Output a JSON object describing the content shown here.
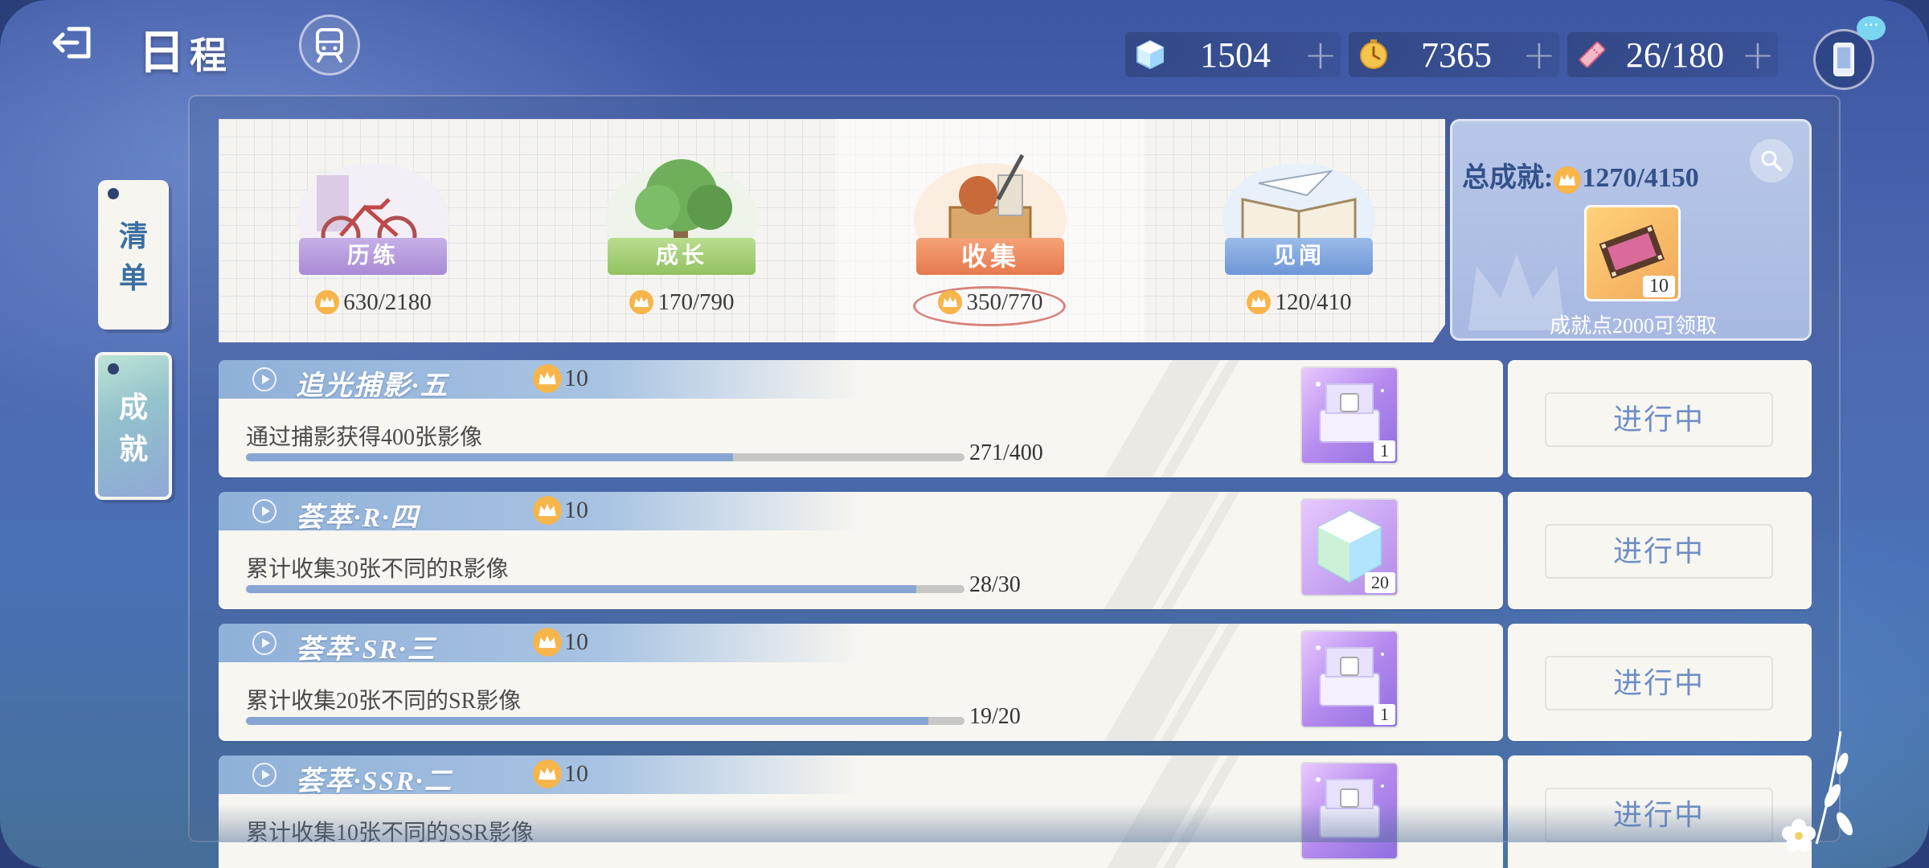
{
  "header": {
    "title_main": "日",
    "title_rest": "程"
  },
  "currencies": [
    {
      "icon": "crystal-icon",
      "value": "1504"
    },
    {
      "icon": "coin-icon",
      "value": "7365"
    },
    {
      "icon": "ticket-icon",
      "value": "26/180"
    }
  ],
  "side_tabs": {
    "list": [
      "清",
      "单"
    ],
    "achievement": [
      "成",
      "就"
    ]
  },
  "categories": [
    {
      "label": "历练",
      "score": "630/2180",
      "ribbon_color": "#b9a0dd",
      "icon": "bicycle-icon"
    },
    {
      "label": "成长",
      "score": "170/790",
      "ribbon_color": "#a6cf7a",
      "icon": "tree-icon"
    },
    {
      "label": "收集",
      "score": "350/770",
      "ribbon_color": "#ef9a70",
      "icon": "collection-box-icon"
    },
    {
      "label": "见闻",
      "score": "120/410",
      "ribbon_color": "#7ea6e0",
      "icon": "book-icon"
    }
  ],
  "active_category": 2,
  "total": {
    "label": "总成就:",
    "score": "1270/4150",
    "reward_count": "10",
    "hint": "成就点2000可领取"
  },
  "achievements": [
    {
      "name": "追光捕影·五",
      "points": "10",
      "desc": "通过捕影获得400张影像",
      "progress": "271/400",
      "fraction": 0.6775,
      "reward_count": "1",
      "reward_icon": "camera-box-icon",
      "status": "进行中"
    },
    {
      "name": "荟萃·R·四",
      "points": "10",
      "desc": "累计收集30张不同的R影像",
      "progress": "28/30",
      "fraction": 0.9333,
      "reward_count": "20",
      "reward_icon": "crystal-cube-icon",
      "status": "进行中"
    },
    {
      "name": "荟萃·SR·三",
      "points": "10",
      "desc": "累计收集20张不同的SR影像",
      "progress": "19/20",
      "fraction": 0.95,
      "reward_count": "1",
      "reward_icon": "camera-box-icon",
      "status": "进行中"
    },
    {
      "name": "荟萃·SSR·二",
      "points": "10",
      "desc": "累计收集10张不同的SSR影像",
      "progress": "",
      "fraction": 0,
      "reward_count": "",
      "reward_icon": "camera-box-icon",
      "status": "进行中"
    }
  ],
  "colors": {
    "accent_blue": "#6f8fc6",
    "crown_gold": "#f0a030"
  }
}
